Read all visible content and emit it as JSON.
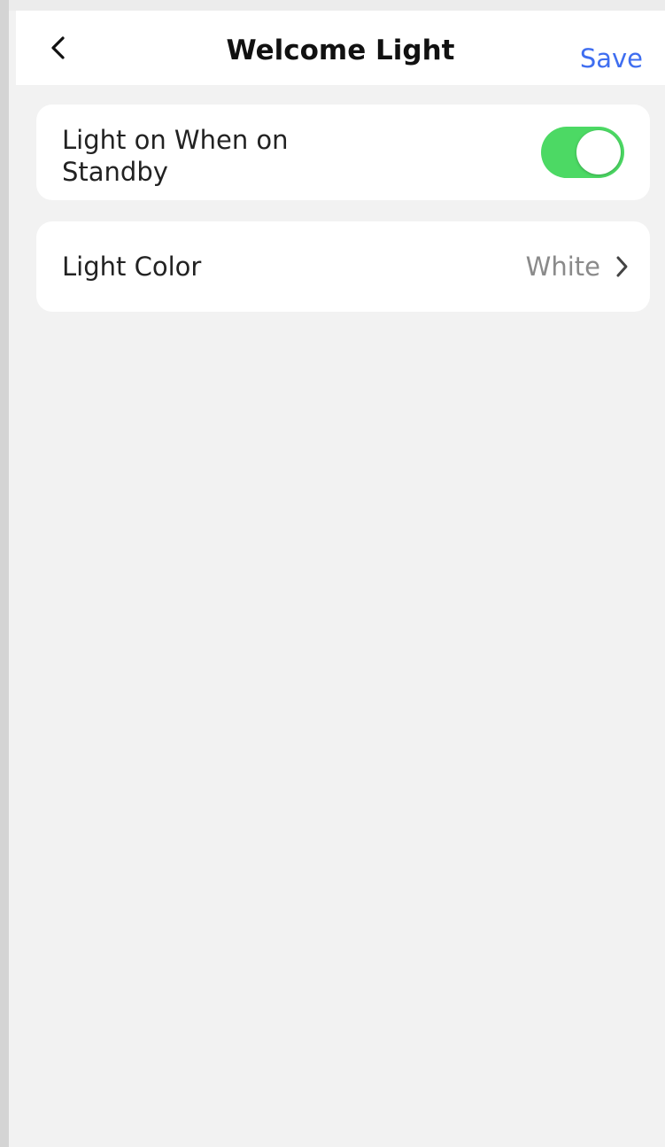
{
  "header": {
    "title": "Welcome Light",
    "save_label": "Save",
    "back_icon": "chevron-left-icon"
  },
  "settings": {
    "standby": {
      "label": "Light on When on Standby",
      "enabled": true,
      "toggle_color": "#4cd964"
    },
    "light_color": {
      "label": "Light Color",
      "value": "White",
      "icon": "chevron-right-icon"
    }
  },
  "colors": {
    "accent": "#3f6ef0",
    "background": "#f2f2f2",
    "card": "#ffffff"
  }
}
